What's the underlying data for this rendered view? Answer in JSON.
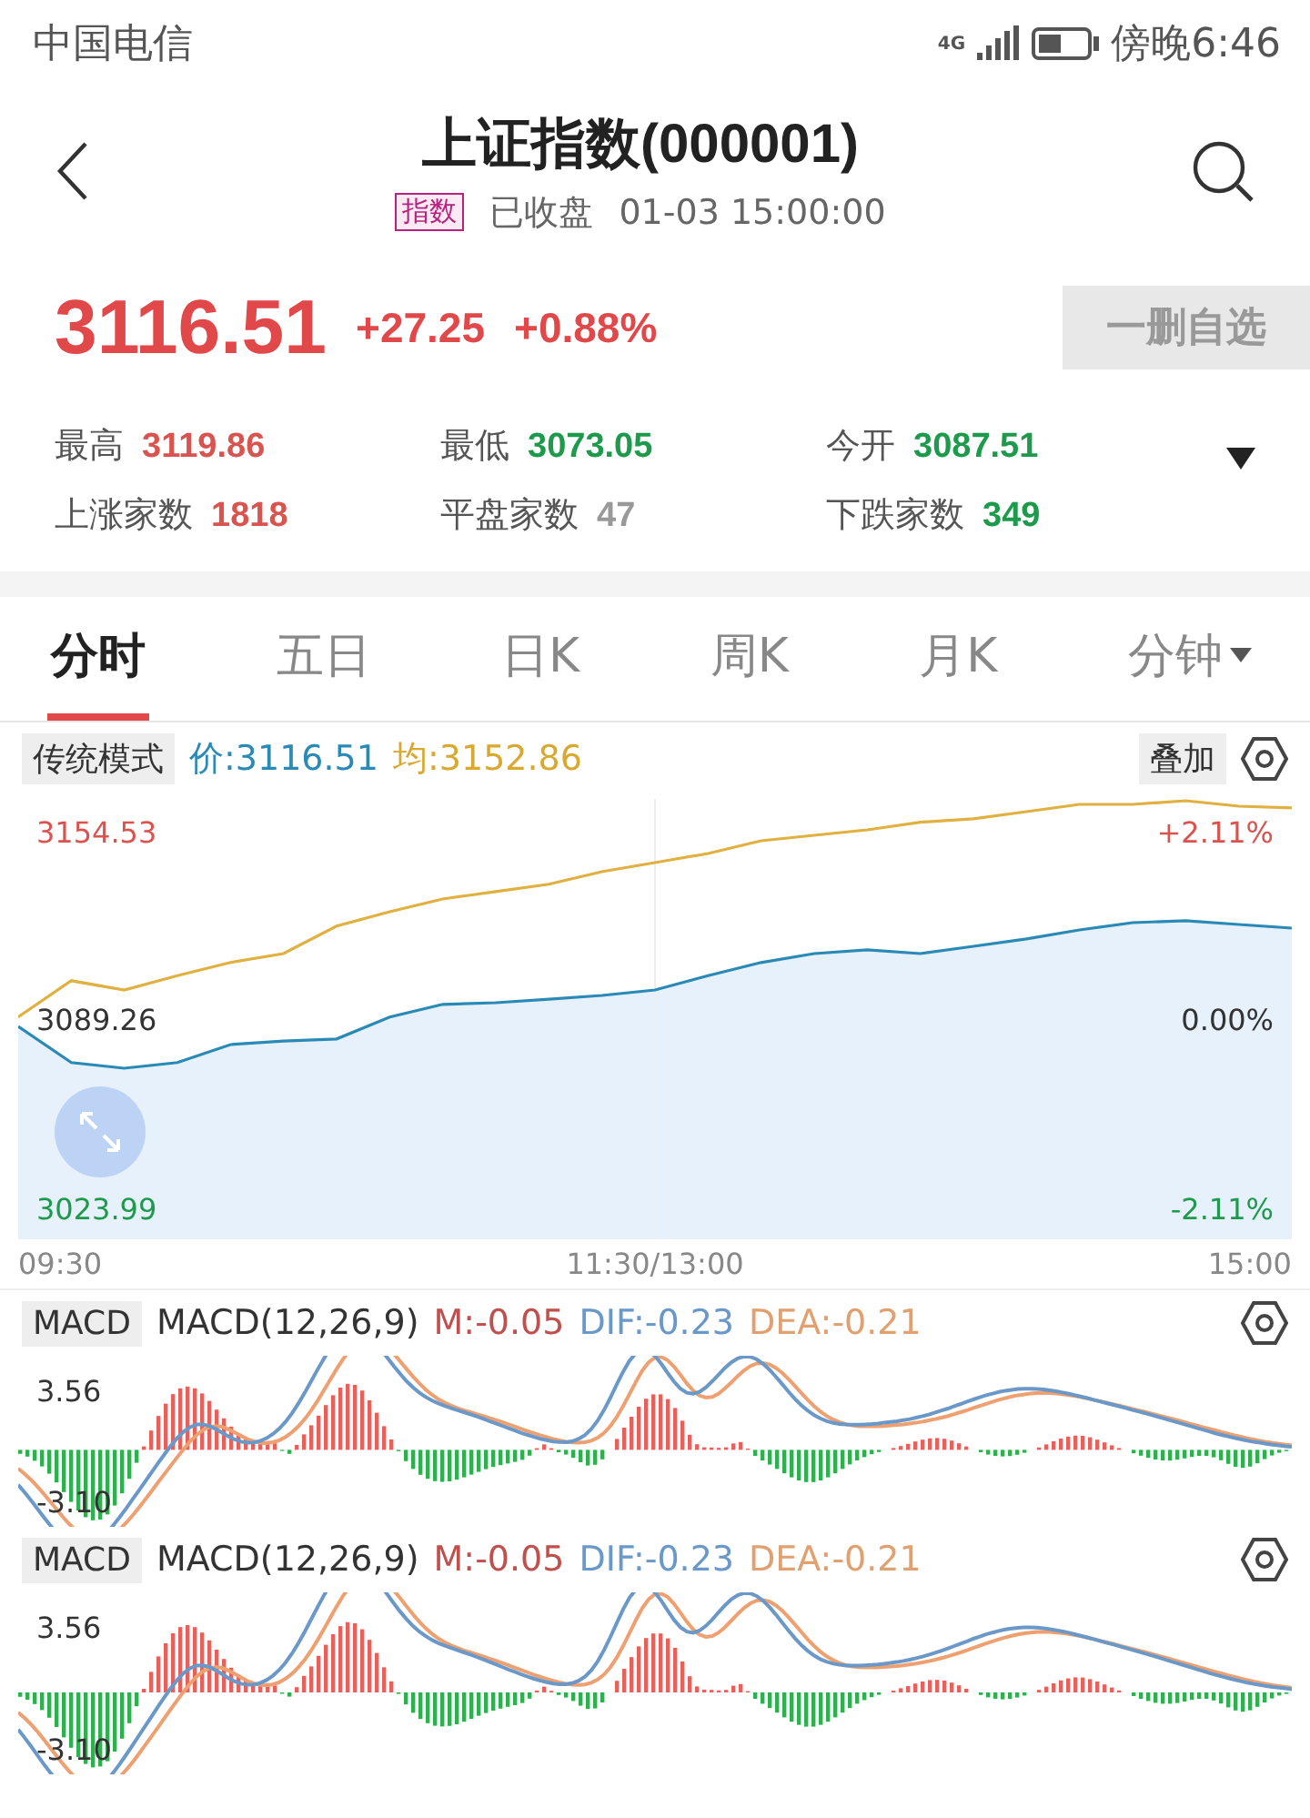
{
  "status_bar": {
    "carrier": "中国电信",
    "network": "4G",
    "time": "傍晚6:46"
  },
  "header": {
    "title": "上证指数(000001)",
    "tag": "指数",
    "state": "已收盘",
    "datetime": "01-03 15:00:00"
  },
  "quote": {
    "price": "3116.51",
    "change": "+27.25",
    "change_pct": "+0.88%",
    "watch_button": "一删自选"
  },
  "stats": [
    {
      "label": "最高",
      "value": "3119.86",
      "color": "#d9534f"
    },
    {
      "label": "最低",
      "value": "3073.05",
      "color": "#1e9a4c"
    },
    {
      "label": "今开",
      "value": "3087.51",
      "color": "#1e9a4c"
    },
    {
      "label": "上涨家数",
      "value": "1818",
      "color": "#d9534f"
    },
    {
      "label": "平盘家数",
      "value": "47",
      "color": "#999999"
    },
    {
      "label": "下跌家数",
      "value": "349",
      "color": "#1e9a4c"
    }
  ],
  "tabs": [
    {
      "label": "分时",
      "selected": true,
      "kind": "plain"
    },
    {
      "label": "五日",
      "selected": false,
      "kind": "plain"
    },
    {
      "label": "日K",
      "selected": false,
      "kind": "plain"
    },
    {
      "label": "周K",
      "selected": false,
      "kind": "plain"
    },
    {
      "label": "月K",
      "selected": false,
      "kind": "plain"
    },
    {
      "label": "分钟",
      "selected": false,
      "kind": "dropdown"
    }
  ],
  "chart": {
    "mode_button": "传统模式",
    "price_legend": "价:3116.51",
    "avg_legend": "均:3152.86",
    "overlay_button": "叠加",
    "right_labels": [
      "+2.11%",
      "0.00%",
      "-2.11%"
    ],
    "time_labels": [
      "09:30",
      "11:30/13:00",
      "15:00"
    ],
    "chart_data": {
      "type": "line",
      "ylim": [
        3013.9,
        3166.5
      ],
      "yticks": [
        {
          "value": 3154.53,
          "label": "3154.53"
        },
        {
          "value": 3089.26,
          "label": "3089.26"
        },
        {
          "value": 3023.99,
          "label": "3023.99"
        }
      ],
      "series": [
        {
          "color": "#e0b040",
          "values": [
            3090.9,
            3103.5,
            3100.3,
            3105.3,
            3109.8,
            3112.9,
            3122.4,
            3127.4,
            3131.8,
            3134.4,
            3136.9,
            3141.3,
            3144.4,
            3147.6,
            3152,
            3153.9,
            3155.8,
            3158.4,
            3159.6,
            3162.1,
            3164.6,
            3164.6,
            3165.9,
            3164,
            3163.4
          ]
        },
        {
          "type": "area",
          "color": "#2a8ab5",
          "values": [
            3087.7,
            3075.1,
            3073.2,
            3075.1,
            3081.4,
            3082.6,
            3083.3,
            3090.9,
            3095.3,
            3095.9,
            3097.1,
            3098.4,
            3100.3,
            3105.3,
            3109.8,
            3112.9,
            3114.2,
            3112.9,
            3115.4,
            3118,
            3121.1,
            3123.6,
            3124.3,
            3123,
            3121.7
          ]
        }
      ]
    }
  },
  "indicators": [
    {
      "button": "MACD",
      "name": "MACD(12,26,9)",
      "m": "M:-0.05",
      "dif": "DIF:-0.23",
      "dea": "DEA:-0.21",
      "max": "3.56",
      "min": "-3.10"
    },
    {
      "button": "MACD",
      "name": "MACD(12,26,9)",
      "m": "M:-0.05",
      "dif": "DIF:-0.23",
      "dea": "DEA:-0.21",
      "max": "3.56",
      "min": "-3.10"
    }
  ]
}
